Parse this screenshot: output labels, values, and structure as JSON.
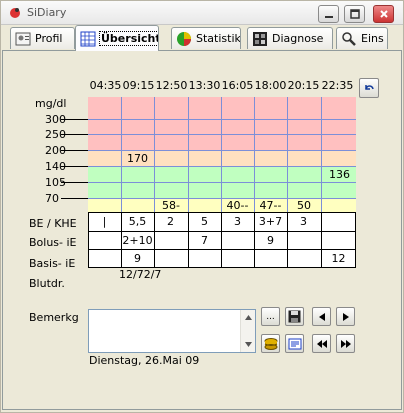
{
  "window": {
    "title": "SiDiary"
  },
  "tabs": [
    {
      "label": "Profil",
      "icon": "profile-icon"
    },
    {
      "label": "Übersicht",
      "icon": "table-icon",
      "active": true
    },
    {
      "label": "Statistik",
      "icon": "pie-chart-icon"
    },
    {
      "label": "Diagnose",
      "icon": "diagnosis-icon"
    },
    {
      "label": "Eins",
      "icon": "settings-icon"
    }
  ],
  "times": [
    "04:35",
    "09:15",
    "12:50",
    "13:30",
    "16:05",
    "18:00",
    "20:15",
    "22:35"
  ],
  "unit": "mg/dl",
  "y_labels": [
    "300",
    "250",
    "200",
    "140",
    "105",
    "70"
  ],
  "band_colors": {
    "high": "#ffc0c0",
    "elevated": "#ffe0c0",
    "normal": "#c0ffc0",
    "low": "#ffffc0"
  },
  "glucose_values": [
    {
      "col": 1,
      "text": "170"
    },
    {
      "col": 7,
      "text": "136"
    }
  ],
  "low_row_values": [
    "",
    "",
    "58-",
    "",
    "40--",
    "47--",
    "50",
    ""
  ],
  "row_labels": {
    "be": "BE / KHE",
    "bolus": "Bolus- iE",
    "basis": "Basis- iE",
    "blood_pressure": "Blutdr."
  },
  "be_values": [
    "|",
    "5,5",
    "2",
    "5",
    "3",
    "3+7",
    "3",
    ""
  ],
  "bolus_values": [
    "",
    "2+10",
    "",
    "7",
    "",
    "9",
    "",
    ""
  ],
  "basis_values": [
    "",
    "9",
    "",
    "",
    "",
    "",
    "",
    "12"
  ],
  "blood_pressure_value": "12/72/7",
  "notes": {
    "label": "Bemerkg",
    "value": ""
  },
  "date": "Dienstag, 26.Mai 09",
  "buttons": {
    "ellipsis": "..."
  }
}
